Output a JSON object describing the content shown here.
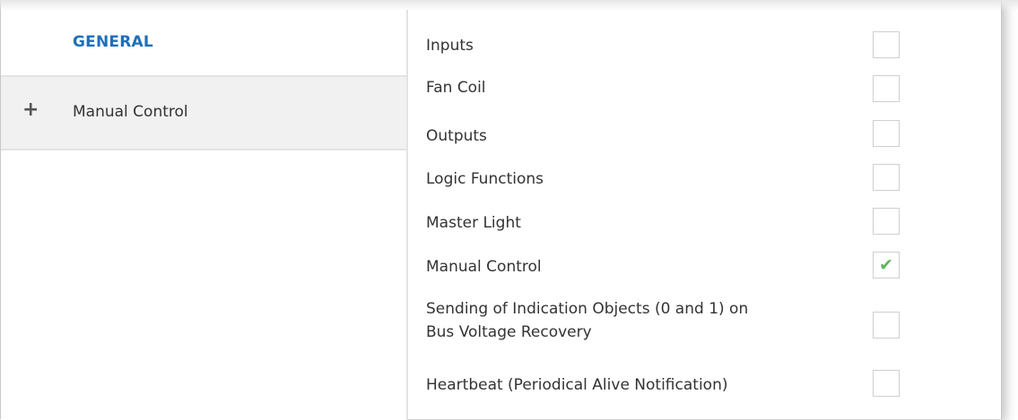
{
  "sidebar": {
    "header": "GENERAL",
    "items": [
      {
        "icon": "plus-icon",
        "label": "Manual Control"
      }
    ]
  },
  "panel": {
    "rows": [
      {
        "label": "Inputs",
        "checked": false
      },
      {
        "label": "Fan Coil",
        "checked": false
      },
      {
        "label": "Outputs",
        "checked": false
      },
      {
        "label": "Logic Functions",
        "checked": false
      },
      {
        "label": "Master Light",
        "checked": false
      },
      {
        "label": "Manual Control",
        "checked": true
      },
      {
        "label_line1": "Sending of Indication Objects (0 and 1) on",
        "label_line2": "Bus Voltage Recovery",
        "checked": false
      },
      {
        "label": "Heartbeat (Periodical Alive Notification)",
        "checked": false
      }
    ]
  },
  "colors": {
    "accent": "#1f6fb9",
    "check": "#5cb85c",
    "selected_bg": "#f1f1f1"
  },
  "glyphs": {
    "plus": "+",
    "check": "✔"
  }
}
